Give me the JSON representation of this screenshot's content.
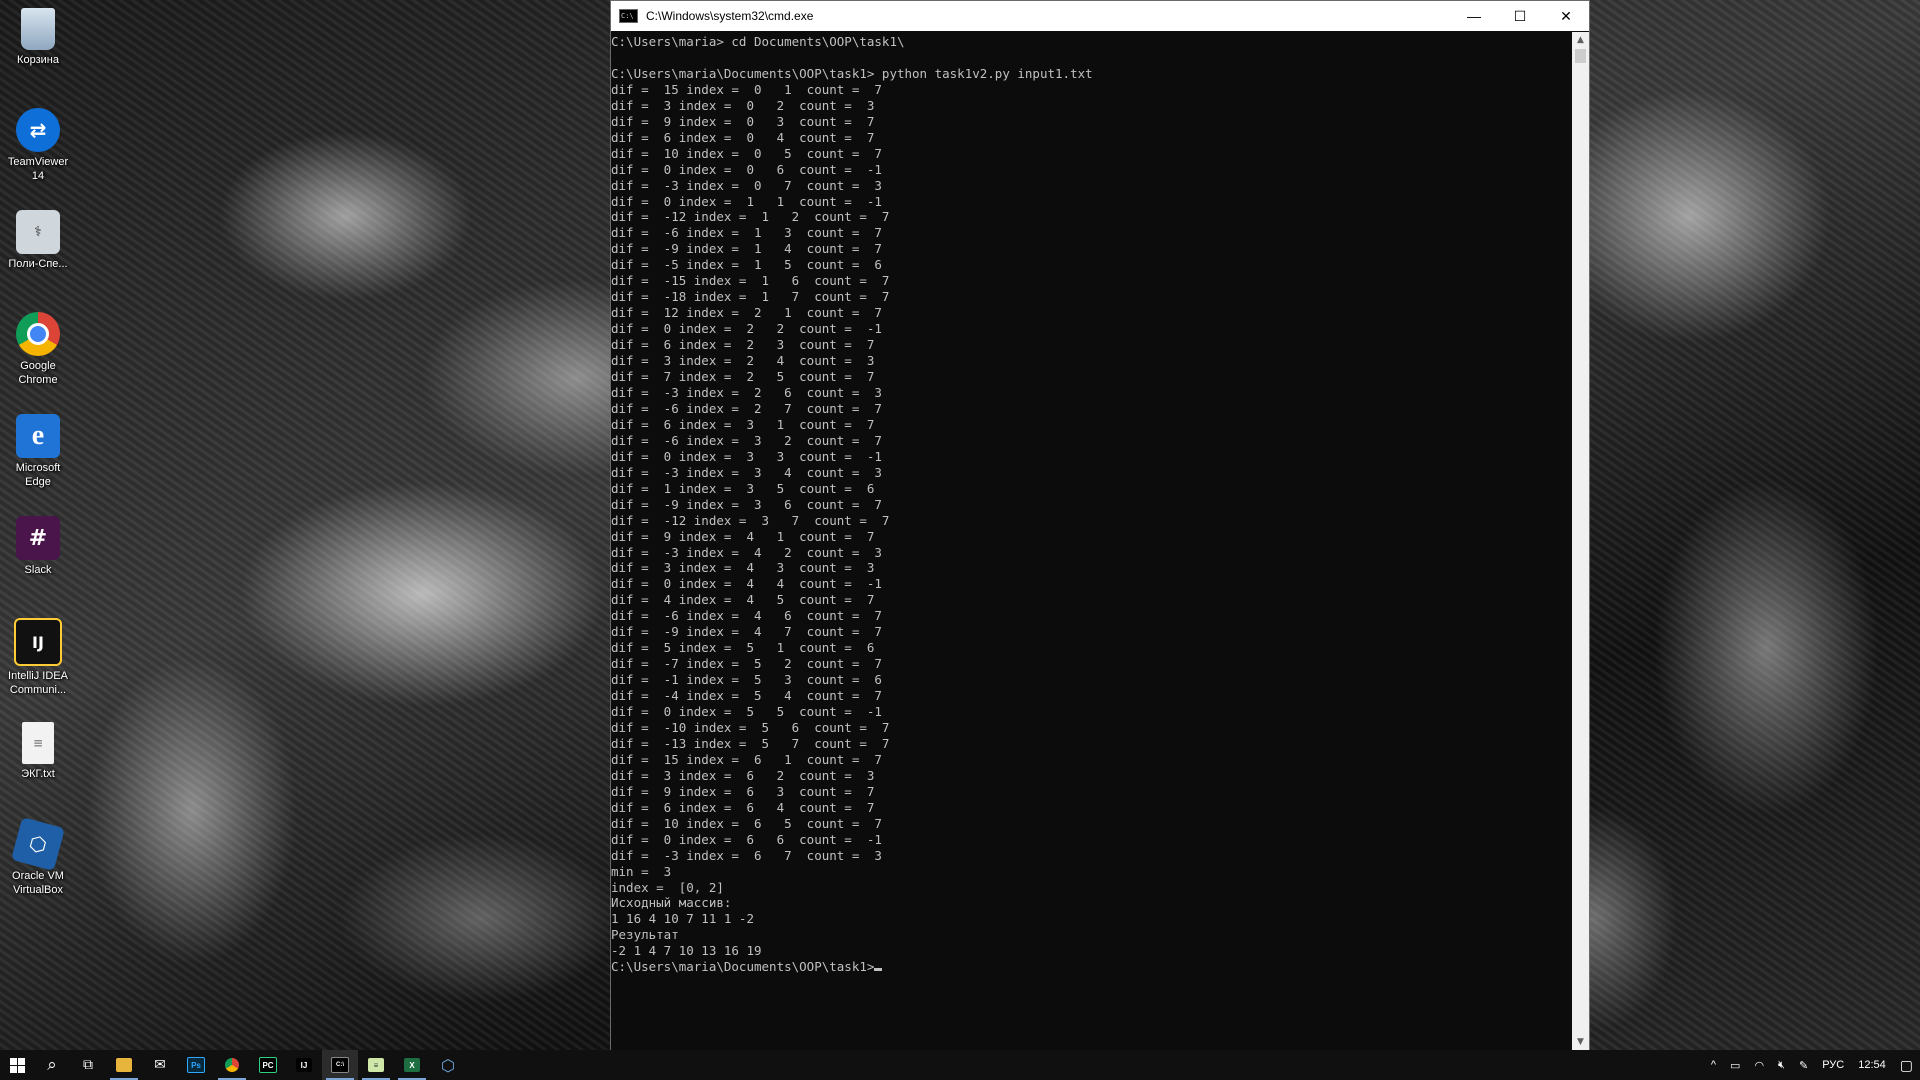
{
  "desktop": {
    "icons": [
      {
        "label": "Корзина",
        "icon": "recycle-bin-icon",
        "color": "#9bb7d4"
      },
      {
        "label": "TeamViewer 14",
        "icon": "teamviewer-icon",
        "color": "#0e6fd8"
      },
      {
        "label": "Поли-Спе...",
        "icon": "poly-spectrum-icon",
        "color": "#cfd6dc"
      },
      {
        "label": "Google Chrome",
        "icon": "chrome-icon",
        "color": "#2b8a3e"
      },
      {
        "label": "Microsoft Edge",
        "icon": "edge-icon",
        "color": "#1f74d6"
      },
      {
        "label": "Slack",
        "icon": "slack-icon",
        "color": "#4a154b"
      },
      {
        "label": "IntelliJ IDEA Communi...",
        "icon": "intellij-icon",
        "color": "#111111"
      },
      {
        "label": "ЭКГ.txt",
        "icon": "text-file-icon",
        "color": "#f2f2f2"
      },
      {
        "label": "Oracle VM VirtualBox",
        "icon": "virtualbox-icon",
        "color": "#1f5fa8"
      }
    ]
  },
  "cmd": {
    "title": "C:\\Windows\\system32\\cmd.exe",
    "minimize": "—",
    "maximize": "☐",
    "close": "✕",
    "lines": [
      "C:\\Users\\maria> cd Documents\\OOP\\task1\\",
      "",
      "C:\\Users\\maria\\Documents\\OOP\\task1> python task1v2.py input1.txt",
      "dif =  15 index =  0   1  count =  7",
      "dif =  3 index =  0   2  count =  3",
      "dif =  9 index =  0   3  count =  7",
      "dif =  6 index =  0   4  count =  7",
      "dif =  10 index =  0   5  count =  7",
      "dif =  0 index =  0   6  count =  -1",
      "dif =  -3 index =  0   7  count =  3",
      "dif =  0 index =  1   1  count =  -1",
      "dif =  -12 index =  1   2  count =  7",
      "dif =  -6 index =  1   3  count =  7",
      "dif =  -9 index =  1   4  count =  7",
      "dif =  -5 index =  1   5  count =  6",
      "dif =  -15 index =  1   6  count =  7",
      "dif =  -18 index =  1   7  count =  7",
      "dif =  12 index =  2   1  count =  7",
      "dif =  0 index =  2   2  count =  -1",
      "dif =  6 index =  2   3  count =  7",
      "dif =  3 index =  2   4  count =  3",
      "dif =  7 index =  2   5  count =  7",
      "dif =  -3 index =  2   6  count =  3",
      "dif =  -6 index =  2   7  count =  7",
      "dif =  6 index =  3   1  count =  7",
      "dif =  -6 index =  3   2  count =  7",
      "dif =  0 index =  3   3  count =  -1",
      "dif =  -3 index =  3   4  count =  3",
      "dif =  1 index =  3   5  count =  6",
      "dif =  -9 index =  3   6  count =  7",
      "dif =  -12 index =  3   7  count =  7",
      "dif =  9 index =  4   1  count =  7",
      "dif =  -3 index =  4   2  count =  3",
      "dif =  3 index =  4   3  count =  3",
      "dif =  0 index =  4   4  count =  -1",
      "dif =  4 index =  4   5  count =  7",
      "dif =  -6 index =  4   6  count =  7",
      "dif =  -9 index =  4   7  count =  7",
      "dif =  5 index =  5   1  count =  6",
      "dif =  -7 index =  5   2  count =  7",
      "dif =  -1 index =  5   3  count =  6",
      "dif =  -4 index =  5   4  count =  7",
      "dif =  0 index =  5   5  count =  -1",
      "dif =  -10 index =  5   6  count =  7",
      "dif =  -13 index =  5   7  count =  7",
      "dif =  15 index =  6   1  count =  7",
      "dif =  3 index =  6   2  count =  3",
      "dif =  9 index =  6   3  count =  7",
      "dif =  6 index =  6   4  count =  7",
      "dif =  10 index =  6   5  count =  7",
      "dif =  0 index =  6   6  count =  -1",
      "dif =  -3 index =  6   7  count =  3",
      "min =  3",
      "index =  [0, 2]",
      "Исходный массив:",
      "1 16 4 10 7 11 1 -2",
      "Результат",
      "-2 1 4 7 10 13 16 19",
      "C:\\Users\\maria\\Documents\\OOP\\task1>"
    ]
  },
  "taskbar": {
    "apps": [
      {
        "name": "start-button",
        "glyph": ""
      },
      {
        "name": "search-icon",
        "glyph": "⌕"
      },
      {
        "name": "task-view-icon",
        "glyph": "▭"
      },
      {
        "name": "file-explorer-icon",
        "glyph": "📁"
      },
      {
        "name": "mail-icon",
        "glyph": "✉"
      },
      {
        "name": "photoshop-icon",
        "glyph": "Ps"
      },
      {
        "name": "chrome-icon",
        "glyph": "◉"
      },
      {
        "name": "pycharm-icon",
        "glyph": "PC"
      },
      {
        "name": "intellij-icon",
        "glyph": "IJ"
      },
      {
        "name": "cmd-icon",
        "glyph": "C:\\"
      },
      {
        "name": "notepad-icon",
        "glyph": "▤"
      },
      {
        "name": "excel-icon",
        "glyph": "X"
      },
      {
        "name": "virtualbox-icon",
        "glyph": "⬡"
      }
    ],
    "tray": {
      "chevron": "^",
      "language": "РУС",
      "time": "12:54"
    }
  }
}
